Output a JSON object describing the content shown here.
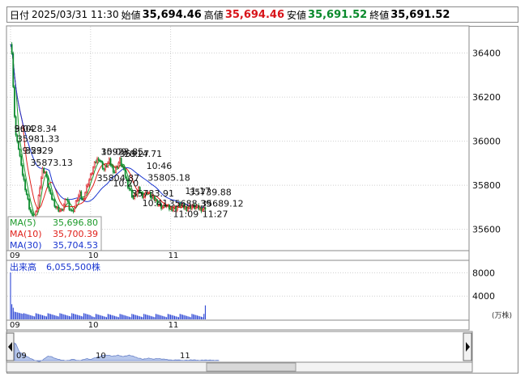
{
  "header": {
    "date_label": "日付",
    "date": "2025/03/31 11:30",
    "open_label": "始値",
    "open": "35,694.46",
    "high_label": "高値",
    "high": "35,694.46",
    "low_label": "安値",
    "low": "35,691.52",
    "close_label": "終値",
    "close": "35,691.52"
  },
  "colors": {
    "candle_up": "#d8141a",
    "candle_down": "#0a8a2c",
    "ma5": "#1c9a2a",
    "ma10": "#e0201a",
    "ma30": "#1a36d0",
    "volume": "#1a36d0",
    "navigator_fill": "#b8c8ec"
  },
  "chart_data": [
    {
      "type": "line",
      "name": "price",
      "y_axis_ticks": [
        36400,
        36200,
        36000,
        35800,
        35600
      ],
      "ylim": [
        35470,
        36520
      ],
      "x_tick_labels": [
        "09",
        "10",
        "11"
      ],
      "legend": [
        {
          "label": "MA(5)",
          "value": "35,696.80"
        },
        {
          "label": "MA(10)",
          "value": "35,700.39"
        },
        {
          "label": "MA(30)",
          "value": "35,704.53"
        }
      ],
      "annotations": [
        {
          "text": "9:04",
          "minute": 4,
          "price": 36028.34
        },
        {
          "text": "36028.34",
          "minute": 4,
          "price": 36028.34
        },
        {
          "text": "35981.33",
          "minute": 6,
          "price": 35981.33
        },
        {
          "text": "9:23",
          "minute": 10,
          "price": 35929
        },
        {
          "text": "35929",
          "minute": 12,
          "price": 35929
        },
        {
          "text": "35873.13",
          "minute": 16,
          "price": 35873.13
        },
        {
          "text": "10:09",
          "minute": 69,
          "price": 35923.85
        },
        {
          "text": "35923.85",
          "minute": 69,
          "price": 35923.85
        },
        {
          "text": "10:27",
          "minute": 86,
          "price": 35914.71
        },
        {
          "text": "35914.71",
          "minute": 83,
          "price": 35914.71
        },
        {
          "text": "35804.87",
          "minute": 66,
          "price": 35804.87
        },
        {
          "text": "10:20",
          "minute": 78,
          "price": 35780
        },
        {
          "text": "10:46",
          "minute": 103,
          "price": 35860
        },
        {
          "text": "35805.18",
          "minute": 104,
          "price": 35805.18
        },
        {
          "text": "35733.91",
          "minute": 92,
          "price": 35733.91
        },
        {
          "text": "11:17",
          "minute": 132,
          "price": 35745
        },
        {
          "text": "35739.88",
          "minute": 135,
          "price": 35739.88
        },
        {
          "text": "10:41",
          "minute": 100,
          "price": 35690
        },
        {
          "text": "35688.39",
          "minute": 120,
          "price": 35688.39
        },
        {
          "text": "35689.12",
          "minute": 144,
          "price": 35689.12
        },
        {
          "text": "11:09",
          "minute": 123,
          "price": 35640
        },
        {
          "text": "11:27",
          "minute": 145,
          "price": 35640
        }
      ]
    },
    {
      "type": "bar",
      "name": "volume",
      "title_label": "出来高",
      "title_value": "6,055,500株",
      "y_axis_ticks": [
        8000,
        4000
      ],
      "unit": "(万株)",
      "x_tick_labels": [
        "09",
        "10",
        "11"
      ]
    },
    {
      "type": "area",
      "name": "navigator",
      "x_tick_labels": [
        "09",
        "10",
        "11"
      ]
    }
  ]
}
